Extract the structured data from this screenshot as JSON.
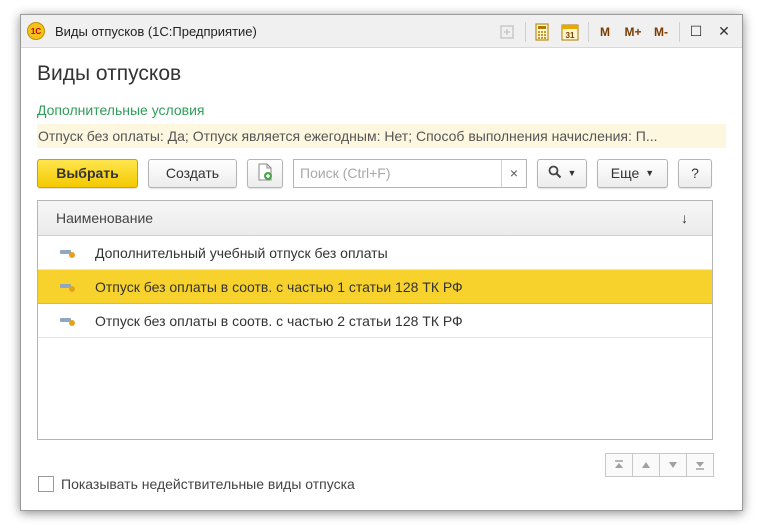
{
  "window": {
    "title": "Виды отпусков  (1С:Предприятие)",
    "toolbar_icons": [
      "favorites-icon",
      "calculator-icon",
      "calendar-icon"
    ],
    "memory_buttons": [
      "M",
      "M+",
      "M-"
    ],
    "maximize_glyph": "☐",
    "close_glyph": "✕"
  },
  "page": {
    "title": "Виды отпусков",
    "conditions_label": "Дополнительные условия",
    "conditions_text": "Отпуск без оплаты: Да; Отпуск является ежегодным: Нет; Способ выполнения начисления: П..."
  },
  "toolbar": {
    "select_label": "Выбрать",
    "create_label": "Создать",
    "search_placeholder": "Поиск (Ctrl+F)",
    "clear_glyph": "×",
    "more_label": "Еще",
    "help_label": "?"
  },
  "table": {
    "column_header": "Наименование",
    "sort_glyph": "↓",
    "rows": [
      {
        "label": "Дополнительный учебный отпуск без оплаты",
        "selected": false
      },
      {
        "label": "Отпуск без оплаты в соотв. с частью 1 статьи 128 ТК РФ",
        "selected": true
      },
      {
        "label": "Отпуск без оплаты в соотв. с частью 2 статьи 128 ТК РФ",
        "selected": false
      }
    ]
  },
  "footer": {
    "checkbox_label": "Показывать недействительные виды отпуска",
    "checked": false
  },
  "colors": {
    "accent_yellow": "#f7d22c",
    "primary_button": "#f4c900",
    "conditions_green": "#2e9e58",
    "conditions_bg": "#fdf7df"
  }
}
